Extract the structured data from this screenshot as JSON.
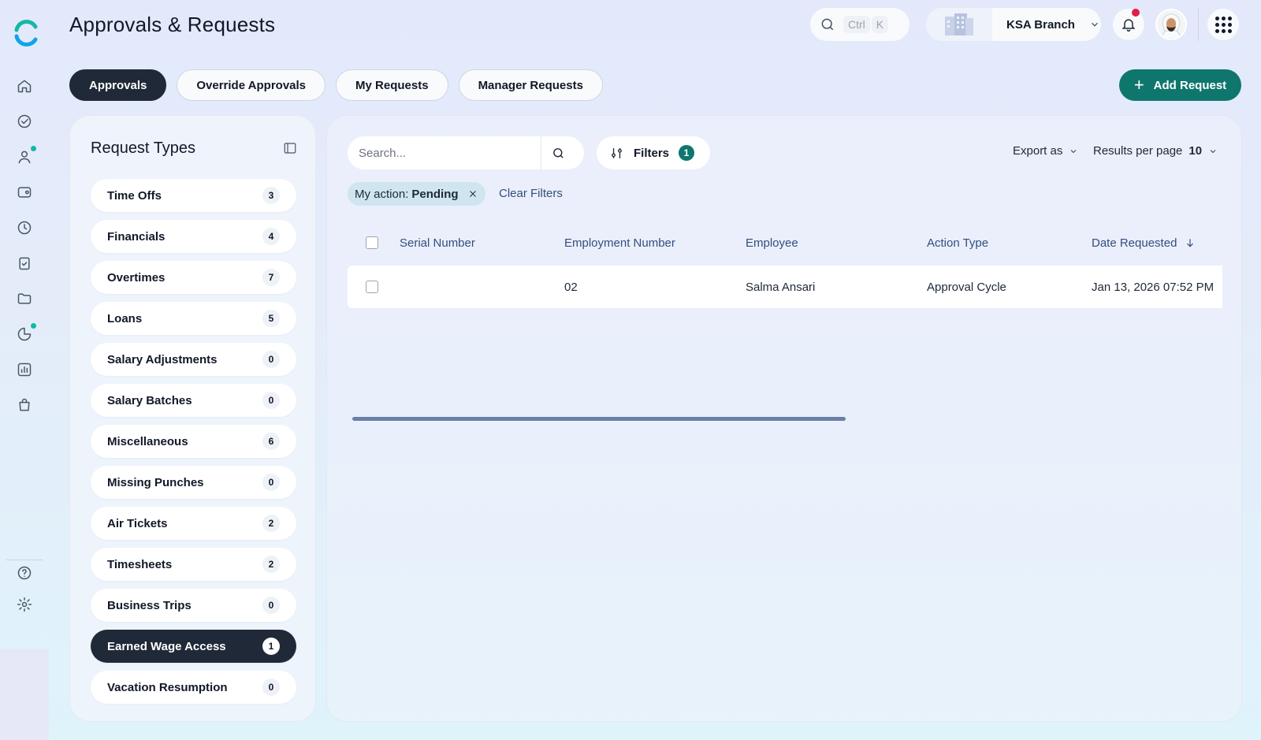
{
  "header": {
    "title": "Approvals & Requests",
    "search_kbd_1": "Ctrl",
    "search_kbd_2": "K",
    "branch_name": "KSA Branch"
  },
  "tabs": [
    {
      "label": "Approvals",
      "active": true
    },
    {
      "label": "Override Approvals",
      "active": false
    },
    {
      "label": "My Requests",
      "active": false
    },
    {
      "label": "Manager Requests",
      "active": false
    }
  ],
  "add_request_label": "Add Request",
  "request_types": {
    "title": "Request Types",
    "items": [
      {
        "label": "Time Offs",
        "count": "3"
      },
      {
        "label": "Financials",
        "count": "4"
      },
      {
        "label": "Overtimes",
        "count": "7"
      },
      {
        "label": "Loans",
        "count": "5"
      },
      {
        "label": "Salary Adjustments",
        "count": "0"
      },
      {
        "label": "Salary Batches",
        "count": "0"
      },
      {
        "label": "Miscellaneous",
        "count": "6"
      },
      {
        "label": "Missing Punches",
        "count": "0"
      },
      {
        "label": "Air Tickets",
        "count": "2"
      },
      {
        "label": "Timesheets",
        "count": "2"
      },
      {
        "label": "Business Trips",
        "count": "0"
      },
      {
        "label": "Earned Wage Access",
        "count": "1",
        "active": true
      },
      {
        "label": "Vacation Resumption",
        "count": "0"
      }
    ]
  },
  "toolbar": {
    "search_placeholder": "Search...",
    "filters_label": "Filters",
    "filters_count": "1",
    "export_label": "Export as",
    "results_per_page_label": "Results per page",
    "results_per_page_value": "10"
  },
  "active_filter": {
    "key": "My action:",
    "value": "Pending",
    "clear_label": "Clear Filters"
  },
  "table": {
    "columns": [
      "Serial Number",
      "Employment Number",
      "Employee",
      "Action Type",
      "Date Requested"
    ],
    "rows": [
      {
        "serial_number": "",
        "employment_number": "02",
        "employee": "Salma Ansari",
        "action_type": "Approval Cycle",
        "date_requested": "Jan 13, 2026 07:52 PM"
      }
    ]
  },
  "colors": {
    "accent": "#0f766e",
    "active_dark": "#1f2937",
    "notification": "#e11d48",
    "rail_dot": "#14b8a6"
  }
}
